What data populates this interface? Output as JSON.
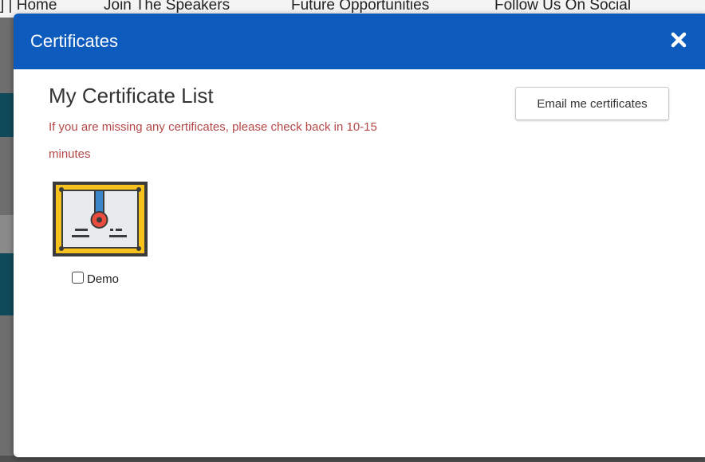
{
  "background": {
    "topbar_items": [
      "] | Home",
      "Join The Speakers",
      "Future Opportunities",
      "Follow Us On Social"
    ]
  },
  "modal": {
    "title": "Certificates",
    "close_icon": "close-icon"
  },
  "certificates": {
    "heading": "My Certificate List",
    "notice": "If you are missing any certificates, please check back in 10-15 minutes",
    "email_button_label": "Email me certificates",
    "items": [
      {
        "name": "Demo",
        "checked": false,
        "icon": "certificate-icon"
      }
    ]
  },
  "colors": {
    "header_bg": "#0d5bbd",
    "notice_text": "#b44848",
    "certificate_frame": "#f6c21b",
    "certificate_seal": "#e84d3d",
    "certificate_ribbon": "#3a86c8"
  }
}
